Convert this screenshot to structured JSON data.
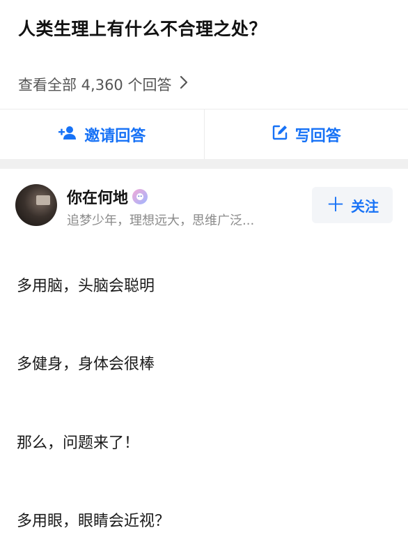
{
  "question": {
    "title": "人类生理上有什么不合理之处？",
    "view_all": "查看全部 4,360 个回答",
    "view_all_chevron": "chevron-right-icon"
  },
  "actions": {
    "invite_label": "邀请回答",
    "invite_icon": "add-person-icon",
    "write_label": "写回答",
    "write_icon": "edit-icon"
  },
  "author": {
    "name": "你在何地",
    "badge_icon": "badge-icon",
    "bio": "追梦少年，理想远大，思维广泛...",
    "follow_label": "关注",
    "follow_icon": "plus-icon"
  },
  "answer": {
    "lines": [
      "多用脑，头脑会聪明",
      "多健身，身体会很棒",
      "那么，问题来了！",
      "多用眼，眼睛会近视？"
    ]
  },
  "colors": {
    "accent": "#1772f6",
    "muted": "#8a8a8a",
    "separator": "#f0f0f0"
  }
}
